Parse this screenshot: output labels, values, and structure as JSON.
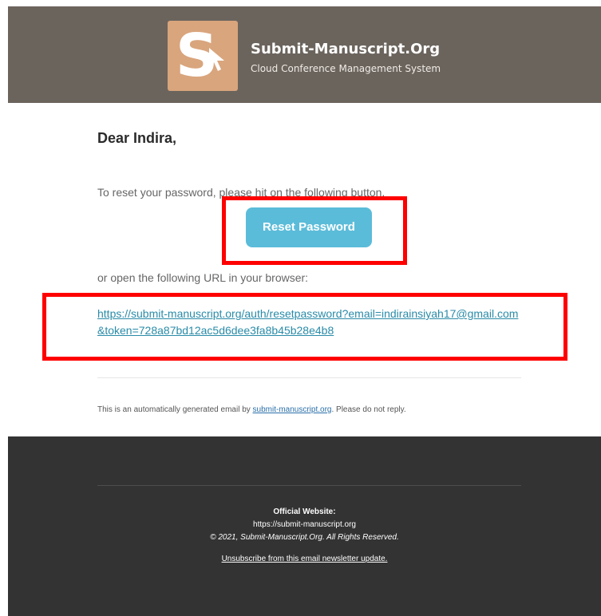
{
  "header": {
    "brand_title": "Submit-Manuscript.Org",
    "brand_subtitle": "Cloud Conference Management System",
    "logo_letter": "S",
    "logo_color": "#d9a57d",
    "background_color": "#6b645d"
  },
  "body": {
    "greeting": "Dear Indira,",
    "intro": "To reset your password, please hit on the following button.",
    "reset_button_label": "Reset Password",
    "or_text": "or open the following URL in your browser:",
    "reset_url": "https://submit-manuscript.org/auth/resetpassword?email=indirainsiyah17@gmail.com&token=728a87bd12ac5d6dee3fa8b45b28e4b8",
    "auto_notice_prefix": "This is an automatically generated email by ",
    "auto_notice_link": "submit-manuscript.org",
    "auto_notice_suffix": ". Please do not reply.",
    "button_color": "#5bbcd9",
    "highlight_color": "#ff0000"
  },
  "footer": {
    "title": "Official Website:",
    "url": "https://submit-manuscript.org",
    "copyright": "© 2021, Submit-Manuscript.Org. All Rights Reserved.",
    "unsubscribe": "Unsubscribe from this email newsletter update.",
    "background_color": "#333333"
  }
}
